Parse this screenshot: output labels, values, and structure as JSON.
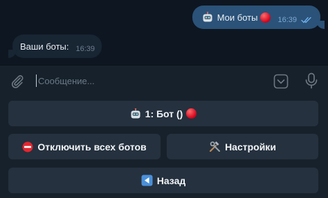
{
  "messages": {
    "outgoing": {
      "text": "Мои боты",
      "time": "16:39",
      "status": "read"
    },
    "incoming": {
      "text": "Ваши боты:",
      "time": "16:39"
    }
  },
  "composer": {
    "placeholder": "Сообщение...",
    "icons": [
      "paperclip-icon",
      "keyboard-toggle-icon",
      "microphone-icon"
    ]
  },
  "keyboard": {
    "bot_button": "1: Бот ()",
    "disable_all_button": "Отключить всех ботов",
    "settings_button": "Настройки",
    "back_button": "Назад"
  },
  "colors": {
    "chat_bg": "#0e1621",
    "outgoing_bubble": "#2b5278",
    "incoming_bubble": "#182533",
    "panel_bg": "#17212b",
    "button_bg": "#25313e"
  }
}
